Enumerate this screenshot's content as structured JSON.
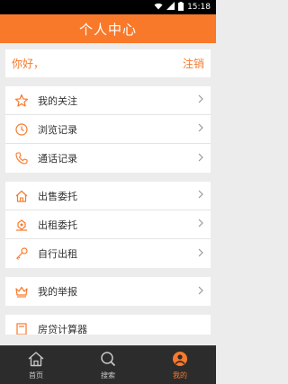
{
  "status": {
    "time": "15:18"
  },
  "header": {
    "title": "个人中心"
  },
  "greeting": {
    "text": "你好，",
    "logout": "注销"
  },
  "groups": [
    {
      "items": [
        {
          "label": "我的关注"
        },
        {
          "label": "浏览记录"
        },
        {
          "label": "通话记录"
        }
      ]
    },
    {
      "items": [
        {
          "label": "出售委托"
        },
        {
          "label": "出租委托"
        },
        {
          "label": "自行出租"
        }
      ]
    },
    {
      "items": [
        {
          "label": "我的举报"
        }
      ]
    }
  ],
  "partial": {
    "label": "房贷计算器"
  },
  "tabs": [
    {
      "label": "首页"
    },
    {
      "label": "搜索"
    },
    {
      "label": "我的"
    }
  ],
  "colors": {
    "accent": "#f9792a"
  }
}
